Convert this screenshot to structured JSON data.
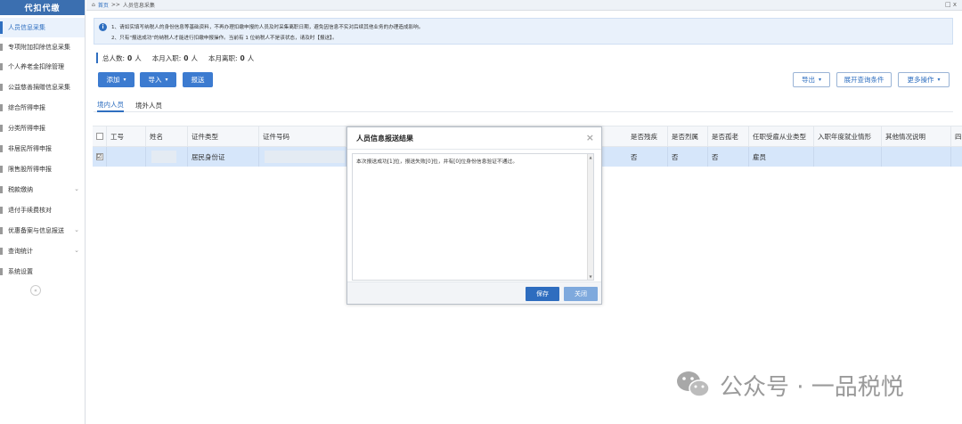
{
  "sidebar": {
    "title": "代扣代缴",
    "items": [
      {
        "label": "人员信息采集",
        "active": true
      },
      {
        "label": "专项附加扣除信息采集"
      },
      {
        "label": "个人养老金扣除管理"
      },
      {
        "label": "公益慈善捐赠信息采集"
      },
      {
        "label": "综合所得申报"
      },
      {
        "label": "分类所得申报"
      },
      {
        "label": "非居民所得申报"
      },
      {
        "label": "限售股所得申报"
      },
      {
        "label": "税款缴纳",
        "expandable": true
      },
      {
        "label": "退付手续费核对"
      },
      {
        "label": "优惠备案与信息报送",
        "expandable": true
      },
      {
        "label": "查询统计",
        "expandable": true
      },
      {
        "label": "系统设置"
      }
    ]
  },
  "topbar": {
    "home": "首页",
    "separator": ">>",
    "current": "人员信息采集",
    "controls": "□ x"
  },
  "notice": {
    "line1": "1、请如实填写纳税人的身份信息等基础资料，不再办理扣缴申报的人员及时采集离职日期，避免因信息不实对后续其他业务的办理造成影响。",
    "line2": "2、只有\"报送成功\"的纳税人才能进行扣缴申报操作。当前有 1 位纳税人不是该状态，请及时【报送】。"
  },
  "stats": {
    "total_label": "总人数:",
    "total_value": "0",
    "total_unit": "人",
    "in_label": "本月入职:",
    "in_value": "0",
    "in_unit": "人",
    "out_label": "本月离职:",
    "out_value": "0",
    "out_unit": "人"
  },
  "toolbar": {
    "add": "添加",
    "import": "导入",
    "submit": "报送",
    "export": "导出",
    "expand_query": "展开查询条件",
    "more": "更多操作"
  },
  "tabs": [
    "境内人员",
    "境外人员"
  ],
  "table": {
    "headers": [
      "工号",
      "姓名",
      "证件类型",
      "证件号码",
      "",
      "是否残疾",
      "是否烈属",
      "是否孤老",
      "任职受雇从业类型",
      "入职年度就业情形",
      "其他情况说明",
      "四"
    ],
    "rows": [
      {
        "checked": "☑",
        "job_no": "",
        "name": "",
        "id_type": "居民身份证",
        "id_no": "",
        "disabled": "否",
        "martyr": "否",
        "lonely_elder": "否",
        "employ_type": "雇员",
        "year_status": "",
        "other": ""
      }
    ]
  },
  "dialog": {
    "title": "人员信息报送结果",
    "message": "本次报送成功[1]位，报送失败[0]位，并有[0]位身份信息验证不通过。",
    "save": "保存",
    "close": "关闭",
    "save_color": "#2e6dbf",
    "close_color": "#7ea9dd"
  },
  "watermark": "公众号 · 一品税悦",
  "colors": {
    "accent": "#2f6fc0",
    "selected_row": "#d6e6fa"
  }
}
